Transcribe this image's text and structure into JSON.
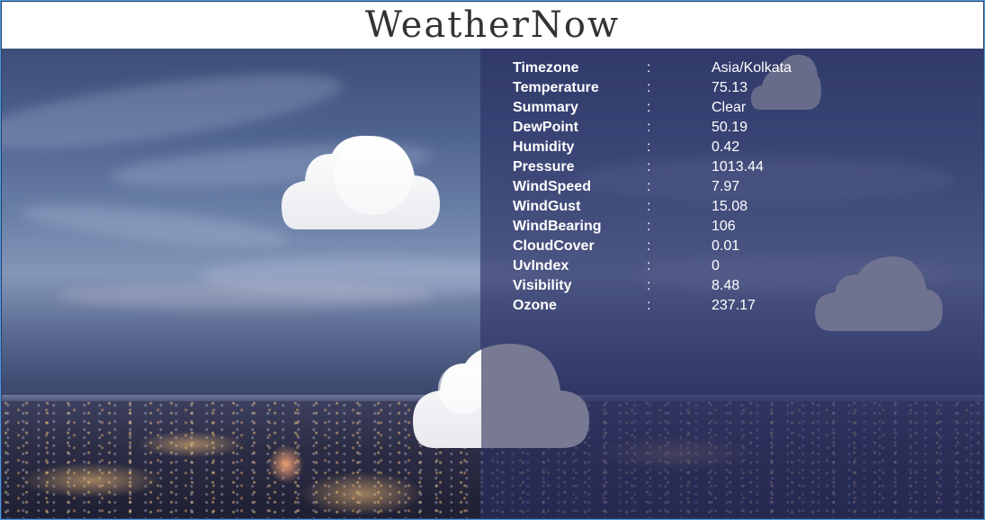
{
  "app": {
    "title": "WeatherNow"
  },
  "weather": {
    "separator": ":",
    "rows": [
      {
        "key": "Timezone",
        "value": "Asia/Kolkata"
      },
      {
        "key": "Temperature",
        "value": "75.13"
      },
      {
        "key": "Summary",
        "value": "Clear"
      },
      {
        "key": "DewPoint",
        "value": "50.19"
      },
      {
        "key": "Humidity",
        "value": "0.42"
      },
      {
        "key": "Pressure",
        "value": "1013.44"
      },
      {
        "key": "WindSpeed",
        "value": "7.97"
      },
      {
        "key": "WindGust",
        "value": "15.08"
      },
      {
        "key": "WindBearing",
        "value": "106"
      },
      {
        "key": "CloudCover",
        "value": "0.01"
      },
      {
        "key": "UvIndex",
        "value": "0"
      },
      {
        "key": "Visibility",
        "value": "8.48"
      },
      {
        "key": "Ozone",
        "value": "237.17"
      }
    ]
  },
  "colors": {
    "header_bg": "#ffffff",
    "frame_border": "#4d9ae0",
    "panel_bg": "rgba(42,46,98,0.62)",
    "text": "#ffffff"
  },
  "icons": [
    "cloud-icon"
  ]
}
